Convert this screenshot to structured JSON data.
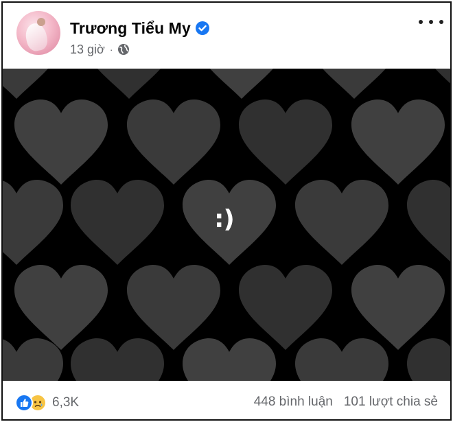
{
  "post": {
    "author_name": "Trương Tiểu My",
    "verified": true,
    "time": "13 giờ",
    "separator": "·",
    "audience_icon": "globe-icon",
    "more_icon": "more-options-icon"
  },
  "image": {
    "overlay_text": ":)",
    "background_color": "#000000",
    "heart_colors": [
      "#3a3a3a",
      "#303030",
      "#404040"
    ]
  },
  "footer": {
    "reaction_icons": [
      "like-icon",
      "sad-icon"
    ],
    "reaction_count": "6,3K",
    "comments": "448 bình luận",
    "shares": "101 lượt chia sẻ"
  },
  "colors": {
    "verified_blue": "#1877f2",
    "secondary_text": "#65676b"
  }
}
